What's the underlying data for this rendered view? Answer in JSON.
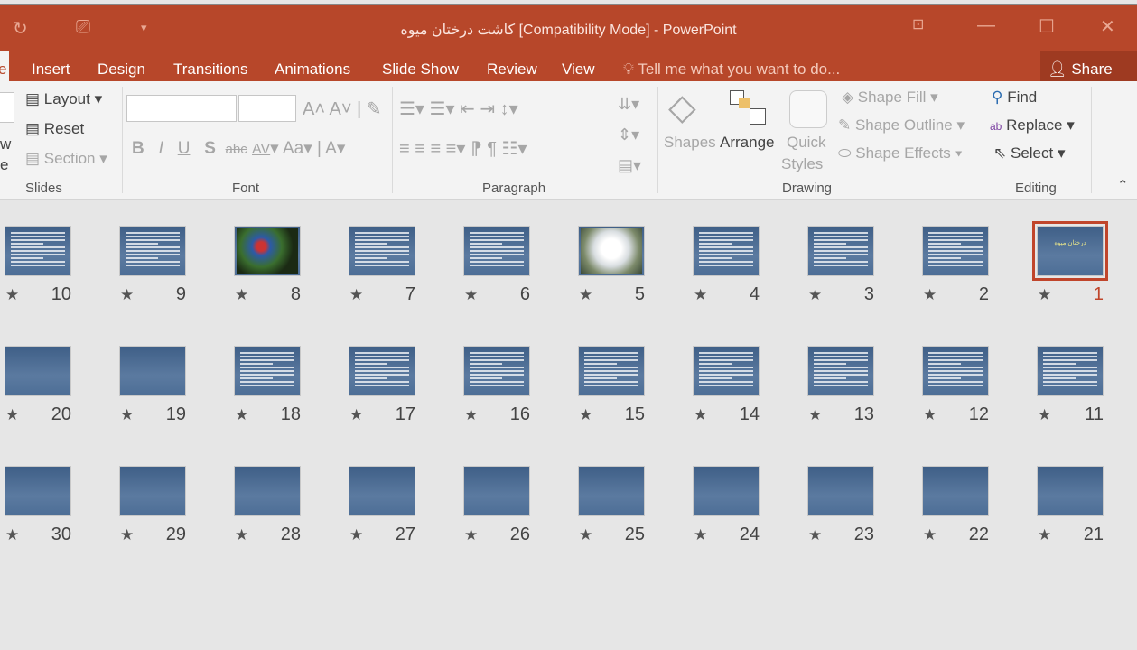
{
  "window": {
    "title": "كاشت درختان ميوه  [Compatibility Mode] - PowerPoint"
  },
  "tabs": [
    {
      "label": "e"
    },
    {
      "label": "Insert"
    },
    {
      "label": "Design"
    },
    {
      "label": "Transitions"
    },
    {
      "label": "Animations"
    },
    {
      "label": "Slide Show"
    },
    {
      "label": "Review"
    },
    {
      "label": "View"
    }
  ],
  "tell_me": "Tell me what you want to do...",
  "share": "Share",
  "ribbon": {
    "slides": {
      "layout": "Layout",
      "reset": "Reset",
      "section": "Section",
      "new_slide_partial": "w",
      "new_slide_partial2": "e",
      "group": "Slides"
    },
    "font": {
      "group": "Font",
      "bold": "B",
      "italic": "I",
      "underline": "U",
      "shadow": "S",
      "strike": "abc",
      "spacing": "AV",
      "case": "Aa",
      "color": "A"
    },
    "paragraph": {
      "group": "Paragraph"
    },
    "drawing": {
      "shapes": "Shapes",
      "arrange": "Arrange",
      "quick": "Quick",
      "styles": "Styles",
      "fill": "Shape Fill",
      "outline": "Shape Outline",
      "effects": "Shape Effects",
      "group": "Drawing"
    },
    "editing": {
      "find": "Find",
      "replace": "Replace",
      "select": "Select",
      "group": "Editing"
    }
  },
  "accent": "#b7472a",
  "slides": [
    {
      "n": "10",
      "type": "text"
    },
    {
      "n": "9",
      "type": "text"
    },
    {
      "n": "8",
      "type": "image"
    },
    {
      "n": "7",
      "type": "text"
    },
    {
      "n": "6",
      "type": "text"
    },
    {
      "n": "5",
      "type": "image2"
    },
    {
      "n": "4",
      "type": "text"
    },
    {
      "n": "3",
      "type": "text"
    },
    {
      "n": "2",
      "type": "text"
    },
    {
      "n": "1",
      "type": "title",
      "title": "درختان ميوه",
      "selected": true
    },
    {
      "n": "20",
      "type": "blank"
    },
    {
      "n": "19",
      "type": "blank"
    },
    {
      "n": "18",
      "type": "text"
    },
    {
      "n": "17",
      "type": "text"
    },
    {
      "n": "16",
      "type": "text"
    },
    {
      "n": "15",
      "type": "text"
    },
    {
      "n": "14",
      "type": "text"
    },
    {
      "n": "13",
      "type": "text"
    },
    {
      "n": "12",
      "type": "text"
    },
    {
      "n": "11",
      "type": "text"
    },
    {
      "n": "30",
      "type": "blank"
    },
    {
      "n": "29",
      "type": "blank"
    },
    {
      "n": "28",
      "type": "blank"
    },
    {
      "n": "27",
      "type": "blank"
    },
    {
      "n": "26",
      "type": "blank"
    },
    {
      "n": "25",
      "type": "blank"
    },
    {
      "n": "24",
      "type": "blank"
    },
    {
      "n": "23",
      "type": "blank"
    },
    {
      "n": "22",
      "type": "blank"
    },
    {
      "n": "21",
      "type": "blank"
    }
  ]
}
